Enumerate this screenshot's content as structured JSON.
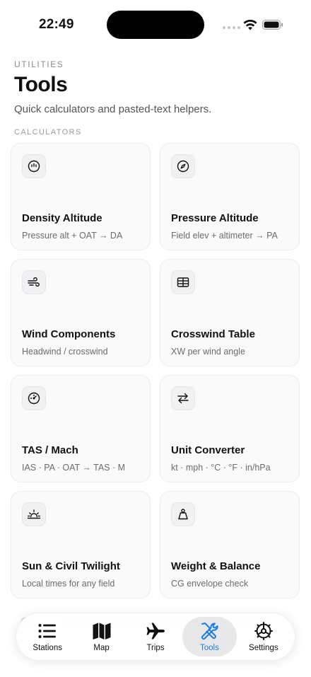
{
  "status_bar": {
    "time": "22:49"
  },
  "header": {
    "eyebrow": "UTILITIES",
    "title": "Tools",
    "subtitle": "Quick calculators and pasted-text helpers."
  },
  "section": {
    "label": "CALCULATORS"
  },
  "tools": [
    {
      "title": "Density Altitude",
      "desc": "Pressure alt + OAT → DA",
      "icon": "gauge-icon"
    },
    {
      "title": "Pressure Altitude",
      "desc": "Field elev + altimeter → PA",
      "icon": "compass-icon"
    },
    {
      "title": "Wind Components",
      "desc": "Headwind / crosswind",
      "icon": "wind-icon"
    },
    {
      "title": "Crosswind Table",
      "desc": "XW per wind angle",
      "icon": "table-icon"
    },
    {
      "title": "TAS / Mach",
      "desc": "IAS · PA · OAT → TAS · M",
      "icon": "speedometer-icon"
    },
    {
      "title": "Unit Converter",
      "desc": "kt · mph · °C · °F · in/hPa",
      "icon": "arrows-swap-icon"
    },
    {
      "title": "Sun & Civil Twilight",
      "desc": "Local times for any field",
      "icon": "sunrise-icon"
    },
    {
      "title": "Weight & Balance",
      "desc": "CG envelope check",
      "icon": "weight-icon"
    }
  ],
  "tab_bar": {
    "tabs": [
      {
        "label": "Stations",
        "icon": "list-icon"
      },
      {
        "label": "Map",
        "icon": "map-icon"
      },
      {
        "label": "Trips",
        "icon": "airplane-icon"
      },
      {
        "label": "Tools",
        "icon": "wrench-screwdriver-icon"
      },
      {
        "label": "Settings",
        "icon": "gear-icon"
      }
    ],
    "active": "Tools"
  },
  "colors": {
    "accent": "#1a7fe0",
    "card_bg": "#fafafb",
    "card_border": "#ececef"
  }
}
